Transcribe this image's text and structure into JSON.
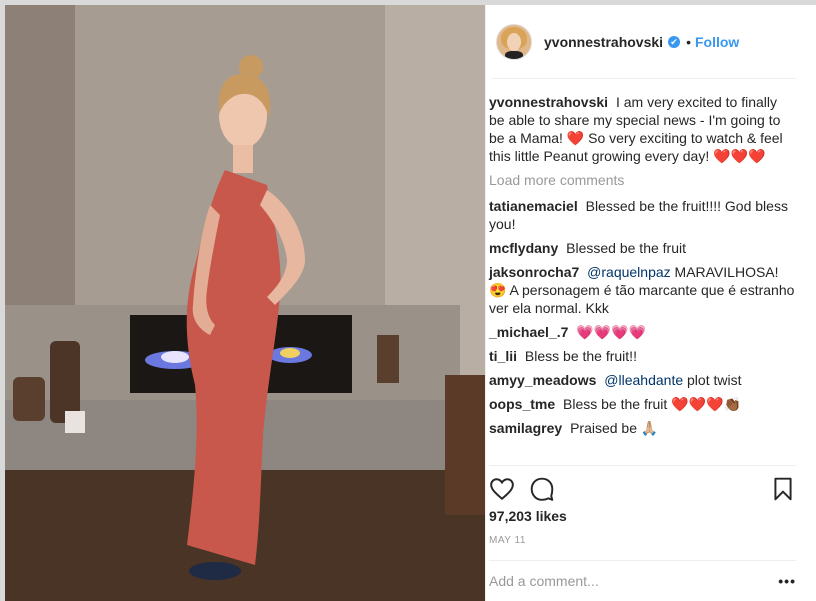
{
  "post": {
    "username": "yvonnestrahovski",
    "verified_label": "✔",
    "separator": "•",
    "follow_label": "Follow",
    "caption": {
      "user": "yvonnestrahovski",
      "text": "I am very excited to finally be able to share my special news - I'm going to be a Mama! ❤️ So very exciting to watch & feel this little Peanut growing every day! ❤️❤️❤️"
    },
    "load_more_label": "Load more comments",
    "comments": [
      {
        "user": "tatianemaciel",
        "text": "Blessed be the fruit!!!! God bless you!"
      },
      {
        "user": "mcflydany",
        "text": "Blessed be the fruit"
      },
      {
        "user": "jaksonrocha7",
        "mention": "@raquelnpaz",
        "text": " MARAVILHOSA! 😍 A personagem é tão marcante que é estranho ver ela normal. Kkk"
      },
      {
        "user": "_michael_.7",
        "text": "💗💗💗💗"
      },
      {
        "user": "ti_lii",
        "text": "Bless be the fruit!!"
      },
      {
        "user": "amyy_meadows",
        "mention": "@lleahdante",
        "text": " plot twist"
      },
      {
        "user": "oops_tme",
        "text": "Bless be the fruit ❤️❤️❤️👏🏾"
      },
      {
        "user": "samilagrey",
        "text": "Praised be 🙏🏼"
      }
    ],
    "icons": {
      "like": "heart-icon",
      "comment": "comment-bubble-icon",
      "save": "bookmark-icon"
    },
    "likes": "97,203 likes",
    "date": "MAY 11",
    "add_comment_placeholder": "Add a comment...",
    "more_label": "•••"
  },
  "colors": {
    "accent": "#3897f0",
    "text": "#262626",
    "muted": "#999999",
    "mention": "#003569"
  }
}
